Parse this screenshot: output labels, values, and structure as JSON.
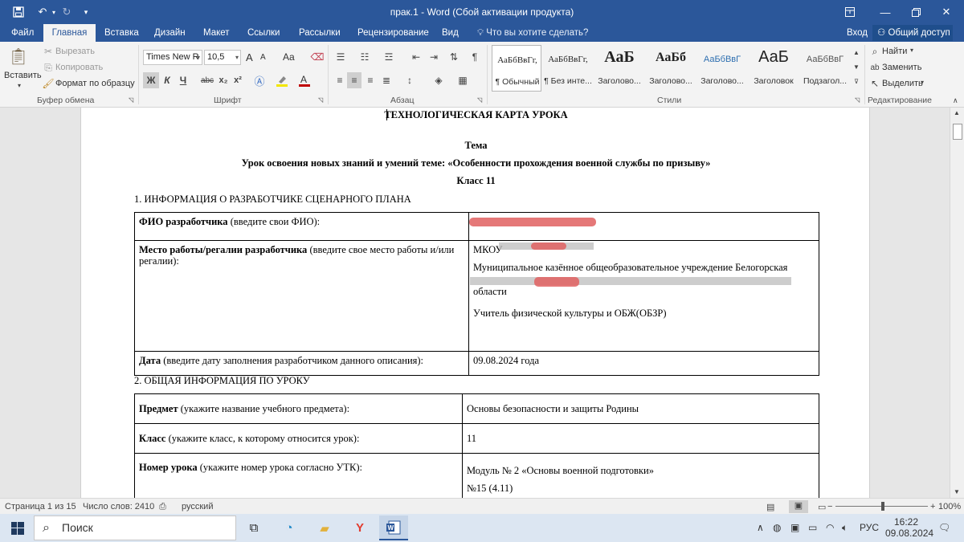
{
  "window": {
    "title": "прак.1 - Word (Сбой активации продукта)",
    "colors": {
      "accent": "#2b579a",
      "page": "#ffffff",
      "redaction": "#e06060"
    }
  },
  "ribbon": {
    "tabs": [
      "Файл",
      "Главная",
      "Вставка",
      "Дизайн",
      "Макет",
      "Ссылки",
      "Рассылки",
      "Рецензирование",
      "Вид"
    ],
    "active_tab": "Главная",
    "tell_me": "Что вы хотите сделать?",
    "sign_in": "Вход",
    "share": "Общий доступ",
    "clipboard": {
      "paste": "Вставить",
      "cut": "Вырезать",
      "copy": "Копировать",
      "format_painter": "Формат по образцу",
      "label": "Буфер обмена"
    },
    "font": {
      "name": "Times New R",
      "size": "10,5",
      "bold": "Ж",
      "italic": "К",
      "underline": "Ч",
      "strike": "abc",
      "subscript": "x₂",
      "superscript": "x²",
      "grow": "A",
      "shrink": "A",
      "case": "Aa",
      "label": "Шрифт"
    },
    "paragraph": {
      "label": "Абзац"
    },
    "styles": {
      "label": "Стили",
      "items": [
        {
          "sample": "АаБбВвГг,",
          "name": "¶ Обычный"
        },
        {
          "sample": "АаБбВвГг,",
          "name": "¶ Без инте..."
        },
        {
          "sample": "АаБ",
          "name": "Заголово..."
        },
        {
          "sample": "АаБб",
          "name": "Заголово..."
        },
        {
          "sample": "АаБбВвГ",
          "name": "Заголово..."
        },
        {
          "sample": "АаБ",
          "name": "Заголовок"
        },
        {
          "sample": "АаБбВвГ",
          "name": "Подзагол..."
        }
      ]
    },
    "editing": {
      "label": "Редактирование",
      "find": "Найти",
      "replace": "Заменить",
      "select": "Выделить"
    }
  },
  "document": {
    "heading": "ТЕХНОЛОГИЧЕСКАЯ КАРТА УРОКА",
    "topic_label": "Тема",
    "topic": "Урок освоения новых знаний и умений теме: «Особенности прохождения военной службы по призыву»",
    "class_line": "Класс 11",
    "section1": "1. ИНФОРМАЦИЯ О РАЗРАБОТЧИКЕ СЦЕНАРНОГО ПЛАНА",
    "t1": {
      "r1_bold": "ФИО разработчика",
      "r1_rest": " (введите свои ФИО):",
      "r2_bold": "Место работы/регалии разработчика",
      "r2_rest": " (введите свое место работы и/или регалии):",
      "r2_val_a": "МКОУ",
      "r2_val_b": "Муниципальное казённое общеобразовательное учреждение Белогорская",
      "r2_val_c": "области",
      "r2_val_d": "Учитель физической культуры и ОБЖ(ОБЗР)",
      "r3_bold": "Дата",
      "r3_rest": " (введите дату заполнения разработчиком данного описания):",
      "r3_val": "09.08.2024 года"
    },
    "section2": "2. ОБЩАЯ ИНФОРМАЦИЯ ПО УРОКУ",
    "t2": {
      "r1_bold": "Предмет",
      "r1_rest": " (укажите название учебного предмета):",
      "r1_val": "Основы безопасности и защиты Родины",
      "r2_bold": "Класс",
      "r2_rest": " (укажите класс, к которому относится урок):",
      "r2_val": "11",
      "r3_bold": "Номер урока",
      "r3_rest": " (укажите номер урока согласно УТК):",
      "r3_val_a": "Модуль № 2 «Основы военной подготовки»",
      "r3_val_b": "№15 (4.11)"
    }
  },
  "status": {
    "page": "Страница 1 из 15",
    "words": "Число слов: 2410",
    "language": "русский",
    "zoom": "100%"
  },
  "taskbar": {
    "search": "Поиск",
    "lang": "РУС",
    "time": "16:22",
    "date": "09.08.2024"
  }
}
